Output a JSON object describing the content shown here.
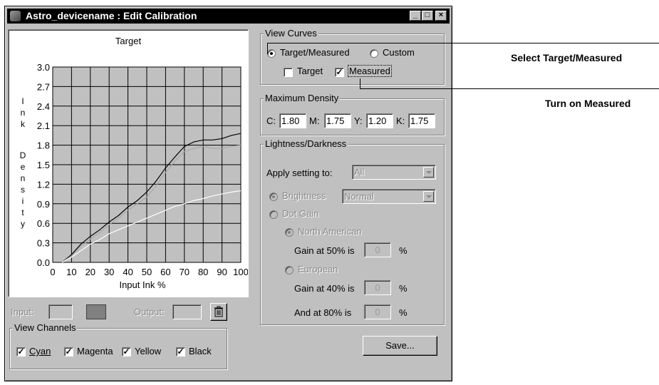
{
  "window": {
    "title": "Astro_devicename : Edit Calibration"
  },
  "target": {
    "label": "Target"
  },
  "chart_data": {
    "type": "line",
    "xlabel": "Input Ink %",
    "ylabel": "Ink Density",
    "ylabel_letters": [
      "I",
      "n",
      "k",
      "D",
      "e",
      "n",
      "s",
      "i",
      "t",
      "y"
    ],
    "xlim": [
      0,
      100
    ],
    "ylim": [
      0,
      3.0
    ],
    "x_ticks": [
      "0",
      "10",
      "20",
      "30",
      "40",
      "50",
      "60",
      "70",
      "80",
      "90",
      "100"
    ],
    "y_ticks": [
      "0.0",
      "0.3",
      "0.6",
      "0.9",
      "1.2",
      "1.5",
      "1.8",
      "2.1",
      "2.4",
      "2.7",
      "3.0"
    ],
    "grid": true,
    "series": [
      {
        "color": "#000000",
        "x": [
          5,
          10,
          15,
          20,
          25,
          30,
          35,
          40,
          45,
          50,
          55,
          60,
          65,
          70,
          75,
          80,
          85,
          90,
          95,
          100
        ],
        "values": [
          0.0,
          0.12,
          0.28,
          0.4,
          0.5,
          0.62,
          0.72,
          0.85,
          0.95,
          1.08,
          1.25,
          1.45,
          1.62,
          1.78,
          1.85,
          1.88,
          1.88,
          1.9,
          1.95,
          1.98
        ]
      },
      {
        "color": "#a8a8a8",
        "x": [
          5,
          10,
          15,
          20,
          25,
          30,
          35,
          40,
          45,
          50,
          55,
          60,
          65,
          70,
          75,
          80,
          85,
          90,
          95,
          100
        ],
        "values": [
          0.0,
          0.1,
          0.25,
          0.36,
          0.46,
          0.58,
          0.68,
          0.8,
          0.9,
          1.0,
          1.18,
          1.38,
          1.56,
          1.7,
          1.75,
          1.78,
          1.75,
          1.75,
          1.78,
          1.8
        ]
      },
      {
        "color": "#ffffff",
        "x": [
          5,
          10,
          15,
          20,
          25,
          30,
          35,
          40,
          45,
          50,
          55,
          60,
          65,
          70,
          75,
          80,
          85,
          90,
          95,
          100
        ],
        "values": [
          0.0,
          0.08,
          0.18,
          0.28,
          0.35,
          0.44,
          0.5,
          0.56,
          0.62,
          0.68,
          0.74,
          0.8,
          0.86,
          0.9,
          0.95,
          0.98,
          1.02,
          1.05,
          1.08,
          1.1
        ]
      }
    ]
  },
  "io": {
    "input_label": "Input:",
    "output_label": "Output:"
  },
  "view_channels": {
    "label": "View Channels",
    "items": [
      {
        "label": "Cyan",
        "checked": true
      },
      {
        "label": "Magenta",
        "checked": true
      },
      {
        "label": "Yellow",
        "checked": true
      },
      {
        "label": "Black",
        "checked": true
      }
    ]
  },
  "view_curves": {
    "label": "View Curves",
    "radio_target_measured": "Target/Measured",
    "radio_custom": "Custom",
    "check_target": "Target",
    "check_measured": "Measured"
  },
  "max_density": {
    "label": "Maximum Density",
    "c_label": "C:",
    "c_value": "1.80",
    "m_label": "M:",
    "m_value": "1.75",
    "y_label": "Y:",
    "y_value": "1.20",
    "k_label": "K:",
    "k_value": "1.75"
  },
  "lightness": {
    "label": "Lightness/Darkness",
    "apply_label": "Apply setting to:",
    "apply_value": "All",
    "brightness_label": "Brightness",
    "brightness_value": "Normal",
    "dot_gain_label": "Dot Gain",
    "north_american_label": "North American",
    "gain50_label": "Gain at 50% is",
    "gain50_value": "0",
    "european_label": "European",
    "gain40_label": "Gain at 40% is",
    "gain40_value": "0",
    "and80_label": "And at 80% is",
    "and80_value": "0",
    "percent": "%"
  },
  "save_label": "Save...",
  "annotations": {
    "select_target": "Select Target/Measured",
    "turn_on_measured": "Turn on Measured"
  }
}
